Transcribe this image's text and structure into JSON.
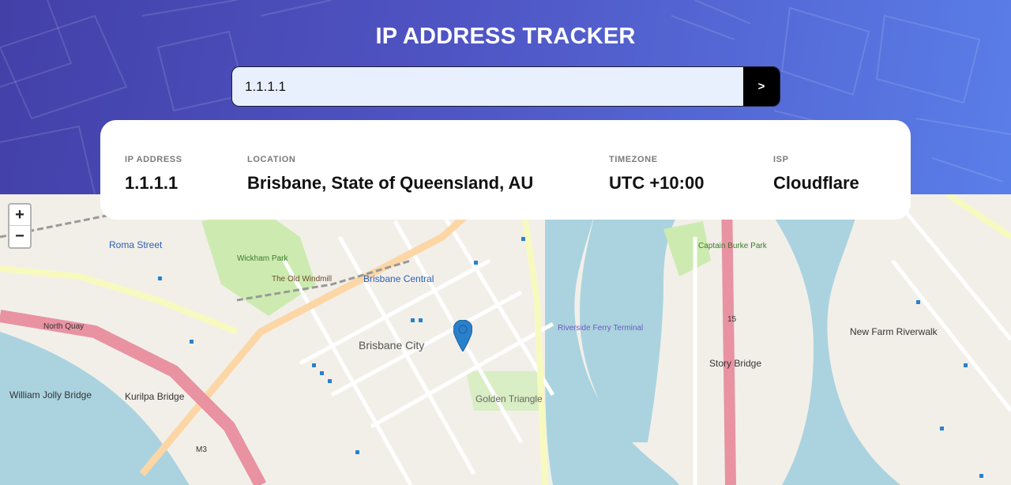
{
  "header": {
    "title": "IP ADDRESS TRACKER",
    "search_value": "1.1.1.1",
    "submit_label": ">"
  },
  "info": {
    "ip_label": "IP ADDRESS",
    "ip_value": "1.1.1.1",
    "location_label": "LOCATION",
    "location_value": "Brisbane, State of Queensland, AU",
    "timezone_label": "TIMEZONE",
    "timezone_value": "UTC +10:00",
    "isp_label": "ISP",
    "isp_value": "Cloudflare"
  },
  "map": {
    "zoom_in": "+",
    "zoom_out": "−",
    "labels": {
      "roma_street": "Roma Street",
      "brisbane_central": "Brisbane Central",
      "brisbane_city": "Brisbane City",
      "golden_triangle": "Golden Triangle",
      "story_bridge": "Story Bridge",
      "new_farm_riverwalk": "New Farm Riverwalk",
      "william_jolly": "William Jolly Bridge",
      "kurilpa": "Kurilpa Bridge",
      "wickham_park": "Wickham Park",
      "old_windmill": "The Old Windmill",
      "captain_burke": "Captain Burke Park",
      "riverside_ferry": "Riverside Ferry Terminal",
      "north_quay": "North Quay",
      "m3": "M3",
      "route15": "15"
    }
  },
  "colors": {
    "header_start": "#4340a8",
    "header_end": "#5a7ee8",
    "river": "#aad3df",
    "land": "#f2efe9",
    "park": "#cdebb0",
    "marker": "#2a81cb"
  }
}
